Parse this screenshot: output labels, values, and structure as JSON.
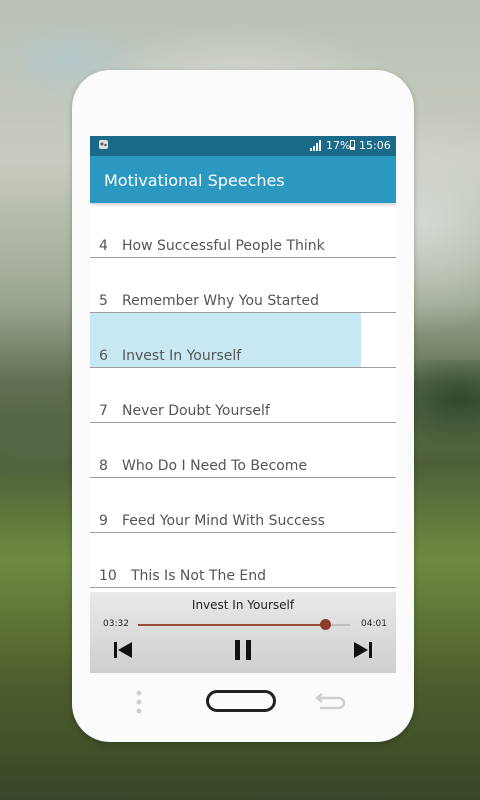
{
  "status_bar": {
    "battery": "17%",
    "time": "15:06"
  },
  "app_bar": {
    "title": "Motivational Speeches"
  },
  "speeches": [
    {
      "num": "4",
      "title": "How Successful People Think"
    },
    {
      "num": "5",
      "title": "Remember Why You Started"
    },
    {
      "num": "6",
      "title": "Invest In Yourself",
      "active": true
    },
    {
      "num": "7",
      "title": "Never Doubt Yourself"
    },
    {
      "num": "8",
      "title": "Who Do I Need To Become"
    },
    {
      "num": "9",
      "title": "Feed Your Mind With Success"
    },
    {
      "num": "10",
      "title": "This Is Not The End"
    }
  ],
  "player": {
    "title": "Invest In Yourself",
    "elapsed": "03:32",
    "duration": "04:01",
    "progress": 0.88
  },
  "colors": {
    "status_bar": "#1c6a8a",
    "app_bar": "#2b98c1",
    "highlight": "#c8e9f4",
    "progress": "#9b4b38"
  }
}
